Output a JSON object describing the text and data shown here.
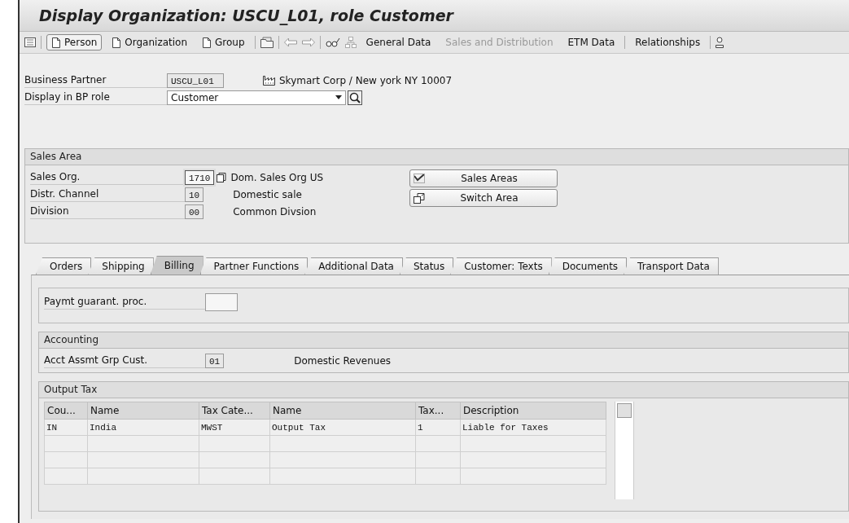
{
  "window": {
    "title": "Display Organization: USCU_L01, role Customer"
  },
  "toolbar": {
    "modes": [
      {
        "label": "Person",
        "selected": true
      },
      {
        "label": "Organization",
        "selected": false
      },
      {
        "label": "Group",
        "selected": false
      }
    ],
    "views": [
      {
        "label": "General Data",
        "disabled": false
      },
      {
        "label": "Sales and Distribution",
        "disabled": true
      },
      {
        "label": "ETM Data",
        "disabled": false
      }
    ],
    "relationships": {
      "label": "Relationships"
    }
  },
  "header": {
    "business_partner": {
      "label": "Business Partner",
      "value": "USCU_L01",
      "description": "Skymart Corp / New york NY 10007"
    },
    "role": {
      "label": "Display in BP role",
      "value": "Customer"
    }
  },
  "sales_area": {
    "title": "Sales Area",
    "rows": [
      {
        "label": "Sales Org.",
        "value": "1710",
        "description": "Dom. Sales Org US",
        "focused": true
      },
      {
        "label": "Distr. Channel",
        "value": "10",
        "description": "Domestic sale",
        "focused": false
      },
      {
        "label": "Division",
        "value": "00",
        "description": "Common Divsion",
        "focused": false
      }
    ],
    "buttons": [
      {
        "label": "Sales Areas"
      },
      {
        "label": "Switch Area"
      }
    ]
  },
  "tabs": [
    {
      "label": "Orders",
      "selected": false
    },
    {
      "label": "Shipping",
      "selected": false
    },
    {
      "label": "Billing",
      "selected": true
    },
    {
      "label": "Partner Functions",
      "selected": false
    },
    {
      "label": "Additional Data",
      "selected": false
    },
    {
      "label": "Status",
      "selected": false
    },
    {
      "label": "Customer: Texts",
      "selected": false
    },
    {
      "label": "Documents",
      "selected": false
    },
    {
      "label": "Transport Data",
      "selected": false
    }
  ],
  "payment": {
    "label": "Paymt guarant. proc."
  },
  "accounting": {
    "title": "Accounting",
    "label": "Acct Assmt Grp Cust.",
    "value": "01",
    "description": "Domestic Revenues"
  },
  "output_tax": {
    "title": "Output Tax",
    "columns": [
      "Cou...",
      "Name",
      "Tax Cate...",
      "Name",
      "Tax...",
      "Description"
    ],
    "rows": [
      [
        "IN",
        "India",
        "MWST",
        "Output Tax",
        "1",
        "Liable for Taxes"
      ]
    ]
  }
}
